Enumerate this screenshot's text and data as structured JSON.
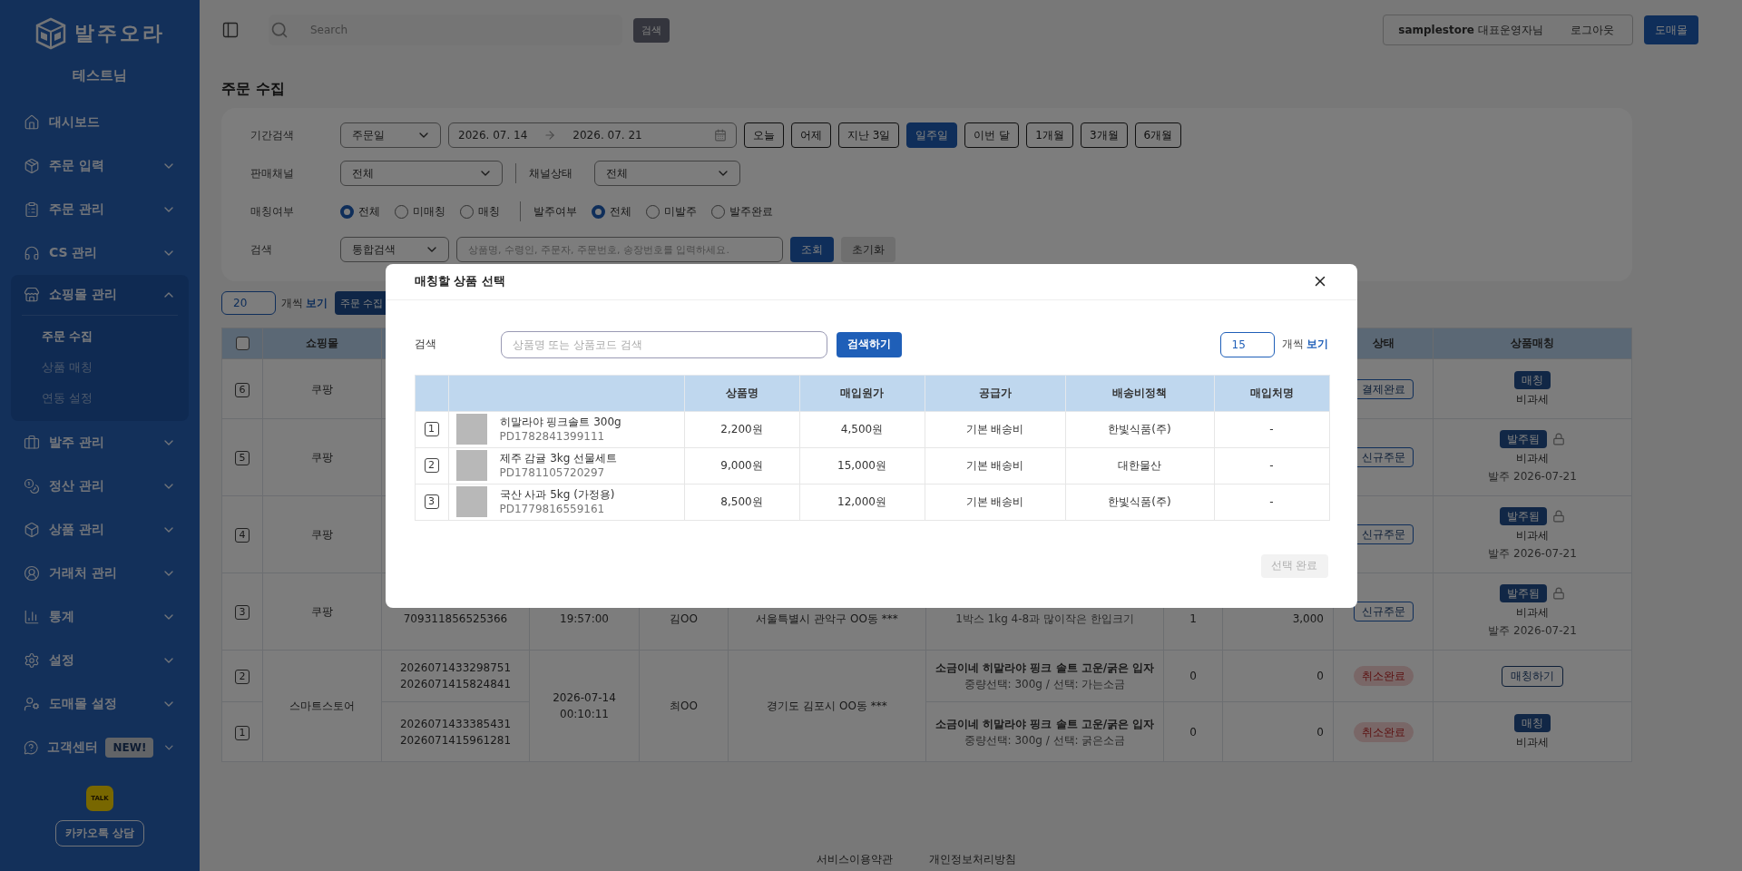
{
  "sidebar": {
    "logo": "발주오라",
    "user": "테스트님",
    "items": [
      {
        "kind": "link",
        "label": "대시보드"
      },
      {
        "kind": "group",
        "label": "주문 입력",
        "expanded": false
      },
      {
        "kind": "group",
        "label": "주문 관리",
        "expanded": false
      },
      {
        "kind": "group",
        "label": "CS 관리",
        "expanded": false
      },
      {
        "kind": "group",
        "label": "쇼핑몰 관리",
        "expanded": true,
        "children": [
          {
            "label": "주문 수집",
            "selected": true
          },
          {
            "label": "상품 매칭",
            "selected": false
          },
          {
            "label": "연동 설정",
            "selected": false
          }
        ]
      },
      {
        "kind": "group",
        "label": "발주 관리",
        "expanded": false
      },
      {
        "kind": "group",
        "label": "정산 관리",
        "expanded": false
      },
      {
        "kind": "group",
        "label": "상품 관리",
        "expanded": false
      },
      {
        "kind": "group",
        "label": "거래처 관리",
        "expanded": false
      },
      {
        "kind": "group",
        "label": "통계",
        "expanded": false
      },
      {
        "kind": "group",
        "label": "설정",
        "expanded": false
      },
      {
        "kind": "group",
        "label": "도매몰 설정",
        "expanded": false
      },
      {
        "kind": "group",
        "label": "고객센터",
        "expanded": false,
        "badge": "NEW!"
      }
    ],
    "kakao": {
      "icon_text": "TALK",
      "button": "카카오톡 상담"
    }
  },
  "topbar": {
    "search_placeholder": "Search",
    "search_button": "검색",
    "store": "samplestore",
    "role": "대표운영자님",
    "logout": "로그아웃",
    "wholesale": "도매몰"
  },
  "page": {
    "title": "주문 수집"
  },
  "filters": {
    "period": {
      "label": "기간검색",
      "select": "주문일",
      "date_from": "2026. 07. 14",
      "date_to": "2026. 07. 21",
      "quick": [
        {
          "label": "오늘",
          "selected": false
        },
        {
          "label": "어제",
          "selected": false
        },
        {
          "label": "지난 3일",
          "selected": false
        },
        {
          "label": "일주일",
          "selected": true
        },
        {
          "label": "이번 달",
          "selected": false
        },
        {
          "label": "1개월",
          "selected": false
        },
        {
          "label": "3개월",
          "selected": false
        },
        {
          "label": "6개월",
          "selected": false
        }
      ]
    },
    "channel": {
      "label": "판매채널",
      "select": "전체",
      "status_label": "채널상태",
      "status_select": "전체"
    },
    "matching": {
      "label": "매칭여부",
      "options": [
        {
          "label": "전체",
          "selected": true
        },
        {
          "label": "미매칭",
          "selected": false
        },
        {
          "label": "매칭",
          "selected": false
        }
      ],
      "order_label": "발주여부",
      "order_options": [
        {
          "label": "전체",
          "selected": true
        },
        {
          "label": "미발주",
          "selected": false
        },
        {
          "label": "발주완료",
          "selected": false
        }
      ]
    },
    "search": {
      "label": "검색",
      "select": "통합검색",
      "placeholder": "상품명, 수령인, 주문자, 주문번호, 송장번호를 입력하세요.",
      "submit": "조회",
      "reset": "초기화"
    }
  },
  "list_bar": {
    "page_size": "20",
    "unit": "개씩",
    "view": "보기",
    "collect_button": "주문 수집"
  },
  "orders": {
    "header_checked": false,
    "columns": [
      "쇼핑몰",
      "상태",
      "상품매칭"
    ],
    "groups": [
      {
        "mall": "쿠팡",
        "rows": [
          {
            "index": "6",
            "status": {
              "kind": "outline",
              "label": "결제완료"
            },
            "match": {
              "kind": "matched",
              "tag": "매칭",
              "tax": "비과세"
            }
          }
        ]
      },
      {
        "mall": "쿠팡",
        "rows": [
          {
            "index": "5",
            "status": {
              "kind": "outline",
              "label": "신규주문"
            },
            "match": {
              "kind": "ordered",
              "tag": "발주됨",
              "tax": "비과세",
              "date": "발주 2026-07-21"
            }
          }
        ]
      },
      {
        "mall": "쿠팡",
        "rows": [
          {
            "index": "4",
            "status": {
              "kind": "outline",
              "label": "신규주문"
            },
            "match": {
              "kind": "ordered",
              "tag": "발주됨",
              "tax": "비과세",
              "date": "발주 2026-07-21"
            }
          }
        ]
      },
      {
        "mall": "쿠팡",
        "datetime": [
          "19:57:00"
        ],
        "buyer": "김OO",
        "address": "서울특별시 관악구 OO동 ***",
        "rows": [
          {
            "index": "3",
            "order_numbers": [
              "709311856525366"
            ],
            "option": "1박스 1kg 4-8과 많이작은 한입크기",
            "qty": "1",
            "amount": "3,000",
            "status": {
              "kind": "outline",
              "label": "신규주문"
            },
            "match": {
              "kind": "ordered",
              "tag": "발주됨",
              "tax": "비과세",
              "date": "발주 2026-07-21"
            }
          }
        ]
      },
      {
        "mall": "스마트스토어",
        "datetime": [
          "2026-07-14",
          "00:10:11"
        ],
        "buyer": "최OO",
        "address": "경기도 김포시 OO동 ***",
        "rows": [
          {
            "index": "2",
            "order_numbers": [
              "2026071433298751",
              "2026071415824841"
            ],
            "product": "소금이네 히말라야 핑크 솔트 고운/굵은 입자",
            "option": "중량선택: 300g / 선택: 가는소금",
            "qty": "0",
            "amount": "0",
            "status": {
              "kind": "cancelled",
              "label": "취소완료"
            },
            "match": {
              "kind": "unmatched",
              "button": "매칭하기"
            }
          },
          {
            "index": "1",
            "order_numbers": [
              "2026071433385431",
              "2026071415961281"
            ],
            "product": "소금이네 히말라야 핑크 솔트 고운/굵은 입자",
            "option": "중량선택: 300g / 선택: 굵은소금",
            "qty": "0",
            "amount": "0",
            "status": {
              "kind": "cancelled",
              "label": "취소완료"
            },
            "match": {
              "kind": "matched",
              "tag": "매칭",
              "tax": "비과세"
            }
          }
        ]
      }
    ]
  },
  "footer": {
    "links": [
      "서비스이용약관",
      "개인정보처리방침"
    ]
  },
  "modal": {
    "title": "매칭할 상품 선택",
    "search_label": "검색",
    "placeholder": "상품명 또는 상품코드 검색",
    "search_button": "검색하기",
    "page_size": "15",
    "unit": "개씩",
    "view": "보기",
    "columns": [
      "상품명",
      "매입원가",
      "공급가",
      "배송비정책",
      "매입처명"
    ],
    "rows": [
      {
        "index": "1",
        "name": "히말라야 핑크솔트 300g",
        "code": "PD1782841399111",
        "cells": [
          "2,200원",
          "4,500원",
          "기본 배송비",
          "한빛식품(주)",
          "-"
        ]
      },
      {
        "index": "2",
        "name": "제주 감귤 3kg 선물세트",
        "code": "PD1781105720297",
        "cells": [
          "9,000원",
          "15,000원",
          "기본 배송비",
          "대한물산",
          "-"
        ]
      },
      {
        "index": "3",
        "name": "국산 사과 5kg (가정용)",
        "code": "PD1779816559161",
        "cells": [
          "8,500원",
          "12,000원",
          "기본 배송비",
          "한빛식품(주)",
          "-"
        ]
      }
    ],
    "confirm": {
      "label": "선택 완료",
      "disabled": true
    }
  }
}
